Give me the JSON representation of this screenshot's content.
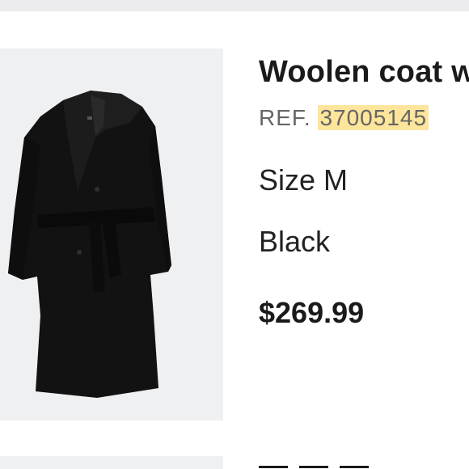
{
  "product": {
    "image_icon": "coat-image",
    "title": "Woolen coat with belt",
    "ref_label": "REF.",
    "ref_number": "37005145",
    "size": "Size M",
    "color": "Black",
    "price": "$269.99"
  },
  "colors": {
    "ref_highlight": "#fde59b",
    "image_bg": "#eff0f2",
    "coat": "#121212"
  }
}
